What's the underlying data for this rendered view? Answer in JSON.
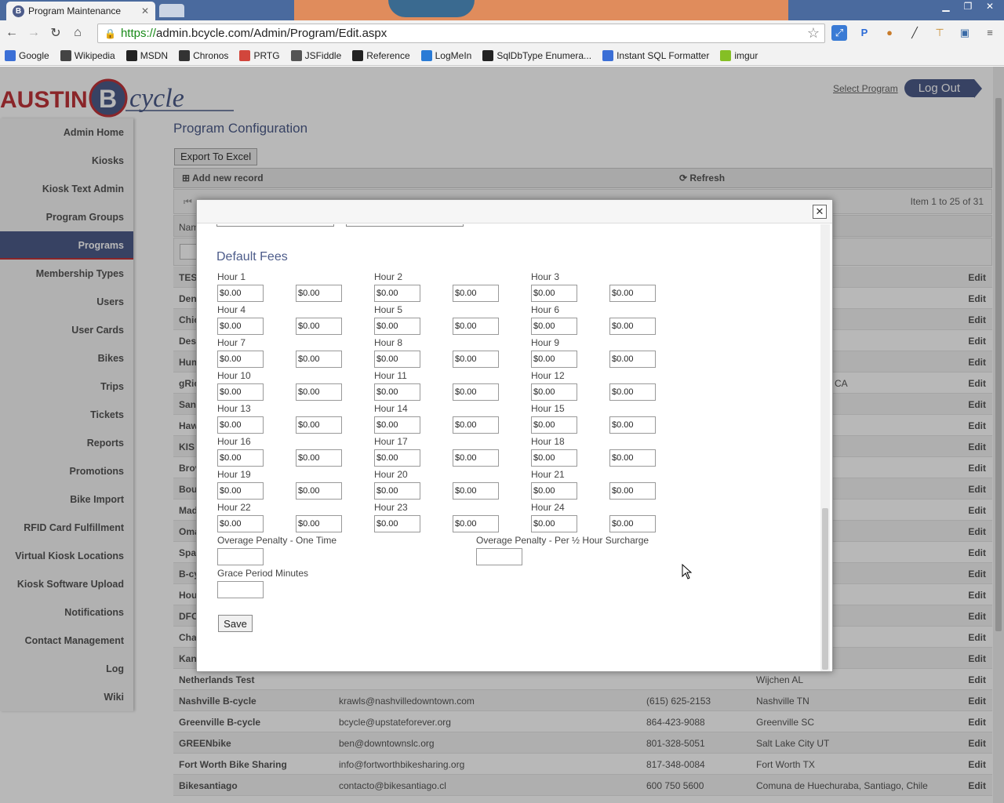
{
  "browser": {
    "tab_title": "Program Maintenance",
    "tab_favicon_letter": "B",
    "url_scheme": "https://",
    "url_rest": "admin.bcycle.com/Admin/Program/Edit.aspx",
    "bookmarks": [
      {
        "label": "Google",
        "icon": "google-icon",
        "color": "#3b6fd6"
      },
      {
        "label": "Wikipedia",
        "icon": "wikipedia-icon",
        "color": "#444444"
      },
      {
        "label": "MSDN",
        "icon": "msdn-icon",
        "color": "#222222"
      },
      {
        "label": "Chronos",
        "icon": "chronos-icon",
        "color": "#333333"
      },
      {
        "label": "PRTG",
        "icon": "prtg-icon",
        "color": "#d2463c"
      },
      {
        "label": "JSFiddle",
        "icon": "jsfiddle-icon",
        "color": "#555555"
      },
      {
        "label": "Reference",
        "icon": "reference-icon",
        "color": "#222222"
      },
      {
        "label": "LogMeIn",
        "icon": "logmein-icon",
        "color": "#2a7bd6"
      },
      {
        "label": "SqlDbType Enumera...",
        "icon": "msdn-icon",
        "color": "#222222"
      },
      {
        "label": "Instant SQL Formatter",
        "icon": "google-icon",
        "color": "#3b6fd6"
      },
      {
        "label": "imgur",
        "icon": "imgur-icon",
        "color": "#85bf25"
      }
    ]
  },
  "header": {
    "logo_text_austin": "AUSTIN",
    "logo_letter": "B",
    "logo_script": "cycle",
    "select_program": "Select Program",
    "logout": "Log Out"
  },
  "sidebar": {
    "items": [
      {
        "label": "Admin Home",
        "active": false
      },
      {
        "label": "Kiosks",
        "active": false
      },
      {
        "label": "Kiosk Text Admin",
        "active": false
      },
      {
        "label": "Program Groups",
        "active": false
      },
      {
        "label": "Programs",
        "active": true
      },
      {
        "label": "Membership Types",
        "active": false
      },
      {
        "label": "Users",
        "active": false
      },
      {
        "label": "User Cards",
        "active": false
      },
      {
        "label": "Bikes",
        "active": false
      },
      {
        "label": "Trips",
        "active": false
      },
      {
        "label": "Tickets",
        "active": false
      },
      {
        "label": "Reports",
        "active": false
      },
      {
        "label": "Promotions",
        "active": false
      },
      {
        "label": "Bike Import",
        "active": false
      },
      {
        "label": "RFID Card Fulfillment",
        "active": false
      },
      {
        "label": "Virtual Kiosk Locations",
        "active": false
      },
      {
        "label": "Kiosk Software Upload",
        "active": false
      },
      {
        "label": "Notifications",
        "active": false
      },
      {
        "label": "Contact Management",
        "active": false
      },
      {
        "label": "Log",
        "active": false
      },
      {
        "label": "Wiki",
        "active": false
      }
    ]
  },
  "main": {
    "title": "Program Configuration",
    "export_label": "Export To Excel",
    "add_record": "Add new record",
    "refresh": "Refresh",
    "pager_info": "Item 1 to 25 of 31",
    "first_col_header": "Nam",
    "edit_label": "Edit",
    "partial_rows": [
      "TES",
      "Den",
      "Chic",
      "Des",
      "Hum",
      "gRic",
      "San",
      "Haw",
      "KIS",
      "Brov",
      "Bou",
      "Mad",
      "Oma",
      "Spa",
      "B-cy",
      "Hou",
      "DFC",
      "Cha",
      "Kan"
    ],
    "partial_city_gric": "o CA",
    "rows": [
      {
        "name": "Netherlands Test",
        "email": "",
        "phone": "",
        "city": "Wijchen AL"
      },
      {
        "name": "Nashville B-cycle",
        "email": "krawls@nashvilledowntown.com",
        "phone": "(615) 625-2153",
        "city": "Nashville TN"
      },
      {
        "name": "Greenville B-cycle",
        "email": "bcycle@upstateforever.org",
        "phone": "864-423-9088",
        "city": "Greenville SC"
      },
      {
        "name": "GREENbike",
        "email": "ben@downtownslc.org",
        "phone": "801-328-5051",
        "city": "Salt Lake City UT"
      },
      {
        "name": "Fort Worth Bike Sharing",
        "email": "info@fortworthbikesharing.org",
        "phone": "817-348-0084",
        "city": "Fort Worth TX"
      },
      {
        "name": "Bikesantiago",
        "email": "contacto@bikesantiago.cl",
        "phone": "600 750 5600",
        "city": "Comuna de Huechuraba, Santiago, Chile"
      }
    ]
  },
  "modal": {
    "close_glyph": "✕",
    "section_title": "Default Fees",
    "hours": [
      "Hour 1",
      "Hour 2",
      "Hour 3",
      "Hour 4",
      "Hour 5",
      "Hour 6",
      "Hour 7",
      "Hour 8",
      "Hour 9",
      "Hour 10",
      "Hour 11",
      "Hour 12",
      "Hour 13",
      "Hour 14",
      "Hour 15",
      "Hour 16",
      "Hour 17",
      "Hour 18",
      "Hour 19",
      "Hour 20",
      "Hour 21",
      "Hour 22",
      "Hour 23",
      "Hour 24"
    ],
    "fee_value": "$0.00",
    "overage_one_time": "Overage Penalty - One Time",
    "overage_per_half": "Overage Penalty - Per ½ Hour Surcharge",
    "grace_period": "Grace Period Minutes",
    "save": "Save"
  }
}
